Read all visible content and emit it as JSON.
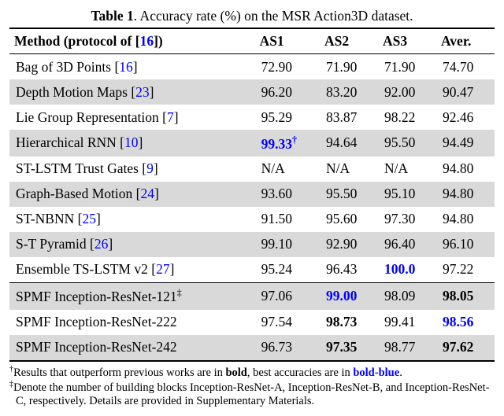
{
  "caption": {
    "label": "Table 1",
    "text": ".  Accuracy rate (%) on the MSR Action3D dataset."
  },
  "headers": {
    "method_prefix": "Method (protocol of [",
    "method_ref": "16",
    "method_suffix": "])",
    "c1": "AS1",
    "c2": "AS2",
    "c3": "AS3",
    "c4": "Aver."
  },
  "rows": [
    {
      "name": "Bag of 3D Points",
      "refopen": " [",
      "ref": "16",
      "refclose": "]",
      "as1": {
        "v": "72.90"
      },
      "as2": {
        "v": "71.90"
      },
      "as3": {
        "v": "71.90"
      },
      "avg": {
        "v": "74.70"
      },
      "shade": false
    },
    {
      "name": "Depth Motion Maps",
      "refopen": " [",
      "ref": "23",
      "refclose": "]",
      "as1": {
        "v": "96.20"
      },
      "as2": {
        "v": "83.20"
      },
      "as3": {
        "v": "92.00"
      },
      "avg": {
        "v": "90.47"
      },
      "shade": true
    },
    {
      "name": "Lie Group Representation",
      "refopen": " [",
      "ref": "7",
      "refclose": "]",
      "as1": {
        "v": "95.29"
      },
      "as2": {
        "v": "83.87"
      },
      "as3": {
        "v": "98.22"
      },
      "avg": {
        "v": "92.46"
      },
      "shade": false
    },
    {
      "name": "Hierarchical RNN",
      "refopen": " [",
      "ref": "10",
      "refclose": "]",
      "as1": {
        "v": "99.33",
        "best": true,
        "sup": "†"
      },
      "as2": {
        "v": "94.64"
      },
      "as3": {
        "v": "95.50"
      },
      "avg": {
        "v": "94.49"
      },
      "shade": true
    },
    {
      "name": "ST-LSTM Trust Gates",
      "refopen": " [",
      "ref": "9",
      "refclose": "]",
      "as1": {
        "v": "N/A"
      },
      "as2": {
        "v": "N/A"
      },
      "as3": {
        "v": "N/A"
      },
      "avg": {
        "v": "94.80"
      },
      "shade": false
    },
    {
      "name": "Graph-Based Motion",
      "refopen": " [",
      "ref": "24",
      "refclose": "]",
      "as1": {
        "v": "93.60"
      },
      "as2": {
        "v": "95.50"
      },
      "as3": {
        "v": "95.10"
      },
      "avg": {
        "v": "94.80"
      },
      "shade": true
    },
    {
      "name": "ST-NBNN",
      "refopen": " [",
      "ref": "25",
      "refclose": "]",
      "as1": {
        "v": "91.50"
      },
      "as2": {
        "v": "95.60"
      },
      "as3": {
        "v": "97.30"
      },
      "avg": {
        "v": "94.80"
      },
      "shade": false
    },
    {
      "name": "S-T Pyramid",
      "refopen": " [",
      "ref": "26",
      "refclose": "]",
      "as1": {
        "v": "99.10"
      },
      "as2": {
        "v": "92.90"
      },
      "as3": {
        "v": "96.40"
      },
      "avg": {
        "v": "96.10"
      },
      "shade": true
    },
    {
      "name": "Ensemble TS-LSTM v2",
      "refopen": " [",
      "ref": "27",
      "refclose": "]",
      "as1": {
        "v": "95.24"
      },
      "as2": {
        "v": "96.43"
      },
      "as3": {
        "v": "100.0",
        "best": true
      },
      "avg": {
        "v": "97.22"
      },
      "shade": false
    },
    {
      "name": "SPMF Inception-ResNet-121",
      "sup": "‡",
      "as1": {
        "v": "97.06"
      },
      "as2": {
        "v": "99.00",
        "best": true
      },
      "as3": {
        "v": "98.09"
      },
      "avg": {
        "v": "98.05",
        "bold": true
      },
      "shade": true,
      "sep": true
    },
    {
      "name": "SPMF Inception-ResNet-222",
      "as1": {
        "v": "97.54"
      },
      "as2": {
        "v": "98.73",
        "bold": true
      },
      "as3": {
        "v": "99.41"
      },
      "avg": {
        "v": "98.56",
        "best": true
      },
      "shade": false
    },
    {
      "name": "SPMF Inception-ResNet-242",
      "as1": {
        "v": "96.73"
      },
      "as2": {
        "v": "97.35",
        "bold": true
      },
      "as3": {
        "v": "98.77"
      },
      "avg": {
        "v": "97.62",
        "bold": true
      },
      "shade": true,
      "last": true
    }
  ],
  "footnotes": {
    "f1_pre": "Results that outperform previous works are in ",
    "f1_bold": "bold",
    "f1_mid": ", best accuracies are in ",
    "f1_best": "bold-blue",
    "f1_end": ".",
    "f2": "Denote the number of building blocks Inception-ResNet-A, Inception-ResNet-B, and Inception-ResNet-C, respectively. Details are provided in Supplementary Materials."
  },
  "chart_data": {
    "type": "table",
    "title": "Accuracy rate (%) on the MSR Action3D dataset",
    "columns": [
      "Method",
      "AS1",
      "AS2",
      "AS3",
      "Aver."
    ],
    "rows": [
      [
        "Bag of 3D Points [16]",
        72.9,
        71.9,
        71.9,
        74.7
      ],
      [
        "Depth Motion Maps [23]",
        96.2,
        83.2,
        92.0,
        90.47
      ],
      [
        "Lie Group Representation [7]",
        95.29,
        83.87,
        98.22,
        92.46
      ],
      [
        "Hierarchical RNN [10]",
        99.33,
        94.64,
        95.5,
        94.49
      ],
      [
        "ST-LSTM Trust Gates [9]",
        "N/A",
        "N/A",
        "N/A",
        94.8
      ],
      [
        "Graph-Based Motion [24]",
        93.6,
        95.5,
        95.1,
        94.8
      ],
      [
        "ST-NBNN [25]",
        91.5,
        95.6,
        97.3,
        94.8
      ],
      [
        "S-T Pyramid [26]",
        99.1,
        92.9,
        96.4,
        96.1
      ],
      [
        "Ensemble TS-LSTM v2 [27]",
        95.24,
        96.43,
        100.0,
        97.22
      ],
      [
        "SPMF Inception-ResNet-121",
        97.06,
        99.0,
        98.09,
        98.05
      ],
      [
        "SPMF Inception-ResNet-222",
        97.54,
        98.73,
        99.41,
        98.56
      ],
      [
        "SPMF Inception-ResNet-242",
        96.73,
        97.35,
        98.77,
        97.62
      ]
    ]
  }
}
